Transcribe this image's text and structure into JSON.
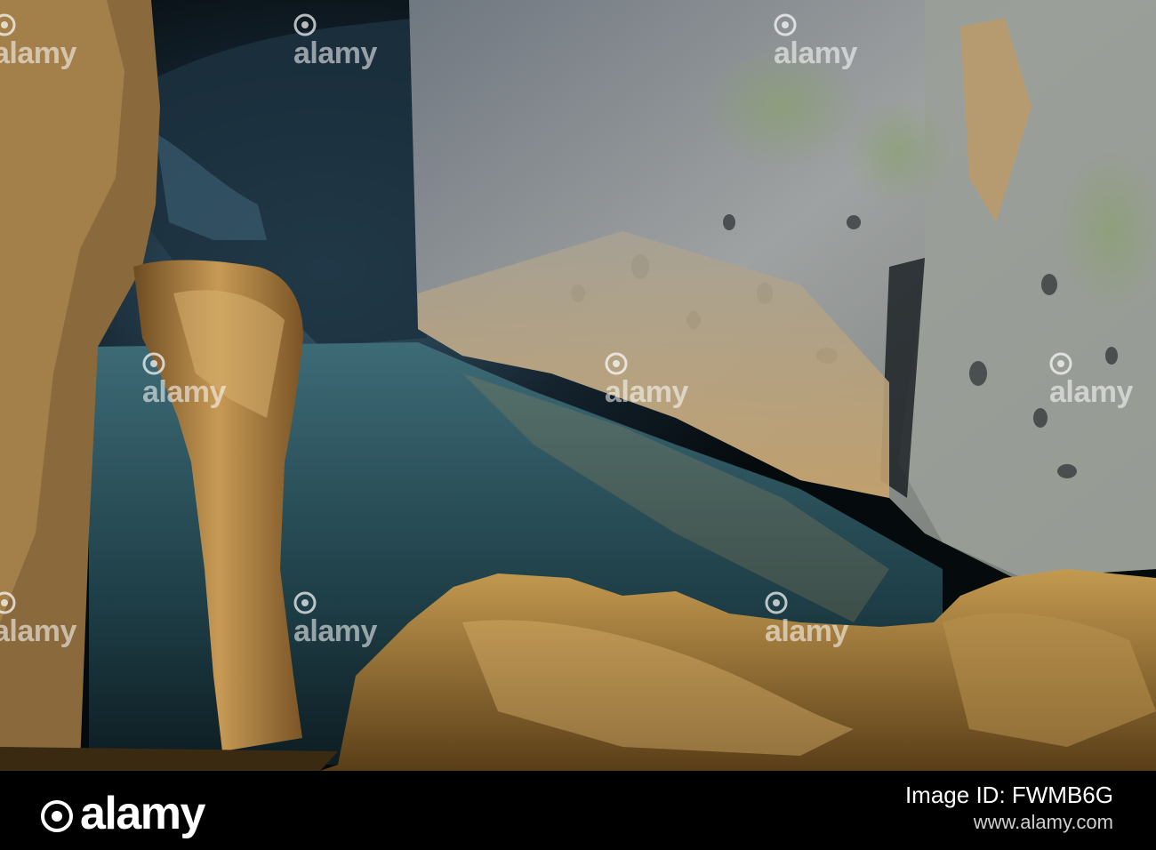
{
  "photo": {
    "subject": "cave-interior-with-water-and-stalagmite-arch",
    "colors": {
      "water": "#2f5964",
      "rock_lit": "#c79a55",
      "rock_wall": "#8c8e8f",
      "shadow": "#050a0d"
    }
  },
  "watermarks": {
    "text": "alamy",
    "icon": "alamy-logo-icon"
  },
  "footer": {
    "brand": "alamy",
    "image_id_label": "Image ID: FWMB6G",
    "url_text": "www.alamy.com"
  }
}
